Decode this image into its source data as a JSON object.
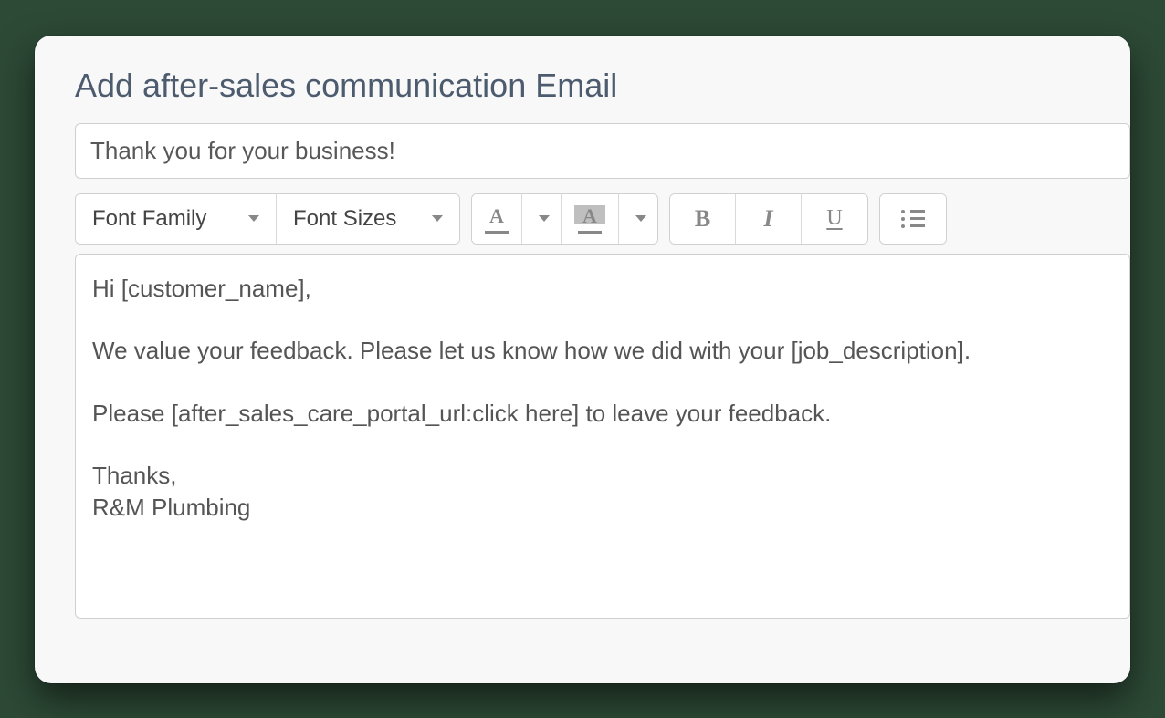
{
  "page": {
    "title": "Add after-sales communication Email"
  },
  "subject": {
    "value": "Thank you for your business!"
  },
  "toolbar": {
    "font_family_label": "Font Family",
    "font_sizes_label": "Font Sizes"
  },
  "body": {
    "text": "Hi [customer_name],\n\nWe value your feedback. Please let us know how we did with your [job_description].\n\nPlease [after_sales_care_portal_url:click here] to leave your feedback.\n\nThanks,\nR&M Plumbing"
  }
}
